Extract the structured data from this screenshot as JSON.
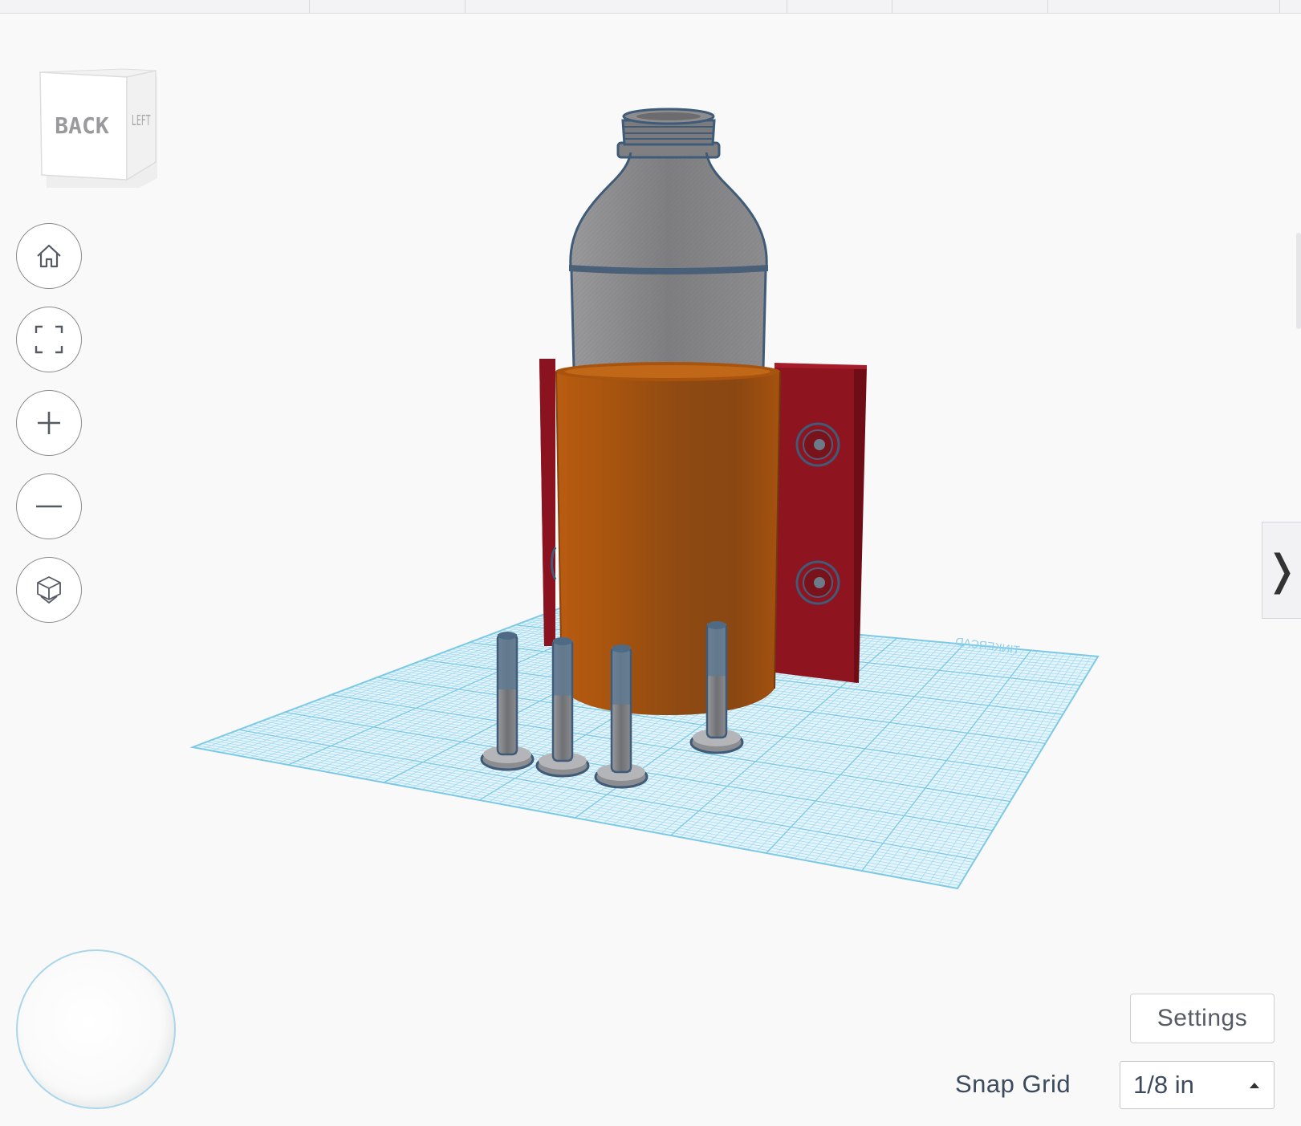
{
  "view_cube": {
    "front_face": "BACK",
    "side_face": "LEFT"
  },
  "nav_buttons": [
    {
      "name": "home-view-button",
      "icon": "home-icon"
    },
    {
      "name": "fit-view-button",
      "icon": "fit-all-icon"
    },
    {
      "name": "zoom-in-button",
      "icon": "plus-icon"
    },
    {
      "name": "zoom-out-button",
      "icon": "minus-icon"
    },
    {
      "name": "perspective-toggle-button",
      "icon": "ortho-cube-icon"
    }
  ],
  "panel_toggle": {
    "glyph": "❭"
  },
  "workplane": {
    "watermark": "TINKERCAD"
  },
  "settings": {
    "label": "Settings"
  },
  "snap_grid": {
    "label": "Snap Grid",
    "value": "1/8 in"
  },
  "colors": {
    "workplane_grid": "#7cc9e6",
    "holder_orange": "#b05a12",
    "bracket_red": "#8c1420",
    "bottle_gray": "#8a8a8c",
    "outline_blue": "#3f5b78"
  }
}
